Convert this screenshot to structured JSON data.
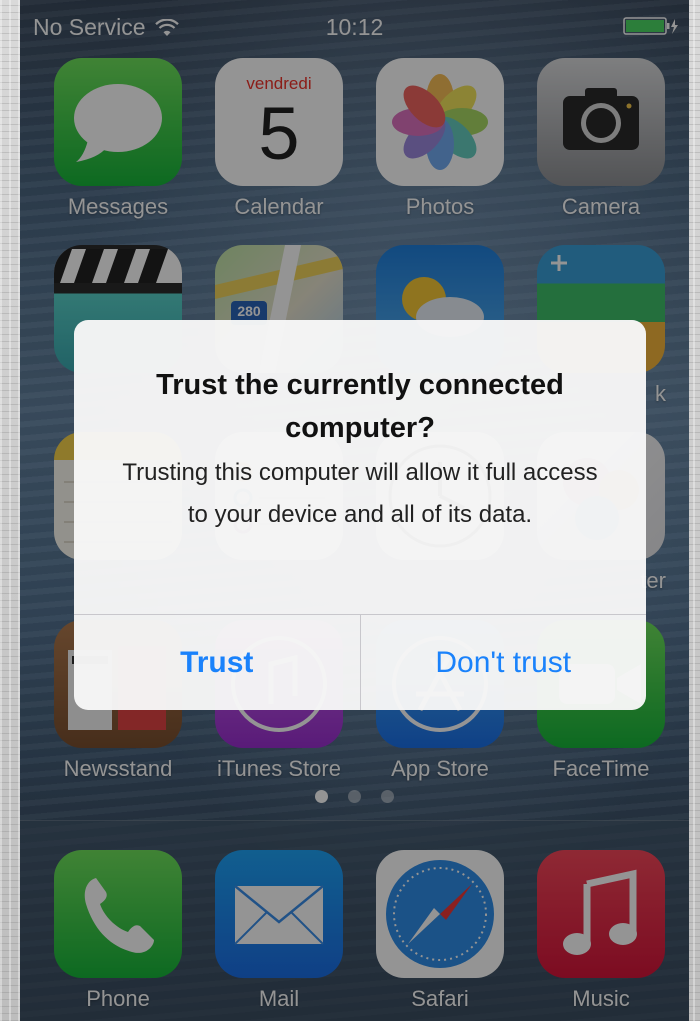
{
  "status_bar": {
    "carrier": "No Service",
    "time": "10:12",
    "icons": [
      "wifi-icon",
      "battery-charging-icon"
    ]
  },
  "home_screen": {
    "apps": [
      {
        "label": "Messages",
        "icon": "messages-icon"
      },
      {
        "label": "Calendar",
        "icon": "calendar-icon",
        "day_name": "vendredi",
        "day_number": "5"
      },
      {
        "label": "Photos",
        "icon": "photos-icon"
      },
      {
        "label": "Camera",
        "icon": "camera-icon"
      },
      {
        "label": "",
        "icon": "videos-icon"
      },
      {
        "label": "",
        "icon": "maps-icon",
        "map_shield": "280"
      },
      {
        "label": "",
        "icon": "weather-icon"
      },
      {
        "label": "k",
        "icon": "passbook-icon"
      },
      {
        "label": "",
        "icon": "notes-icon"
      },
      {
        "label": "",
        "icon": "reminders-icon"
      },
      {
        "label": "",
        "icon": "clock-icon"
      },
      {
        "label": "ter",
        "icon": "game-center-icon"
      },
      {
        "label": "Newsstand",
        "icon": "newsstand-icon"
      },
      {
        "label": "iTunes Store",
        "icon": "itunes-store-icon"
      },
      {
        "label": "App Store",
        "icon": "app-store-icon"
      },
      {
        "label": "FaceTime",
        "icon": "facetime-icon"
      }
    ],
    "page_indicator": {
      "pages": 3,
      "current": 1
    }
  },
  "dock": {
    "apps": [
      {
        "label": "Phone",
        "icon": "phone-icon"
      },
      {
        "label": "Mail",
        "icon": "mail-icon"
      },
      {
        "label": "Safari",
        "icon": "safari-icon"
      },
      {
        "label": "Music",
        "icon": "music-icon"
      }
    ]
  },
  "alert": {
    "title": "Trust the currently connected computer?",
    "message": "Trusting this computer will allow it full access to your device and all of its data.",
    "buttons": {
      "trust": "Trust",
      "dont_trust": "Don't trust"
    }
  },
  "colors": {
    "accent": "#1a82fb"
  }
}
